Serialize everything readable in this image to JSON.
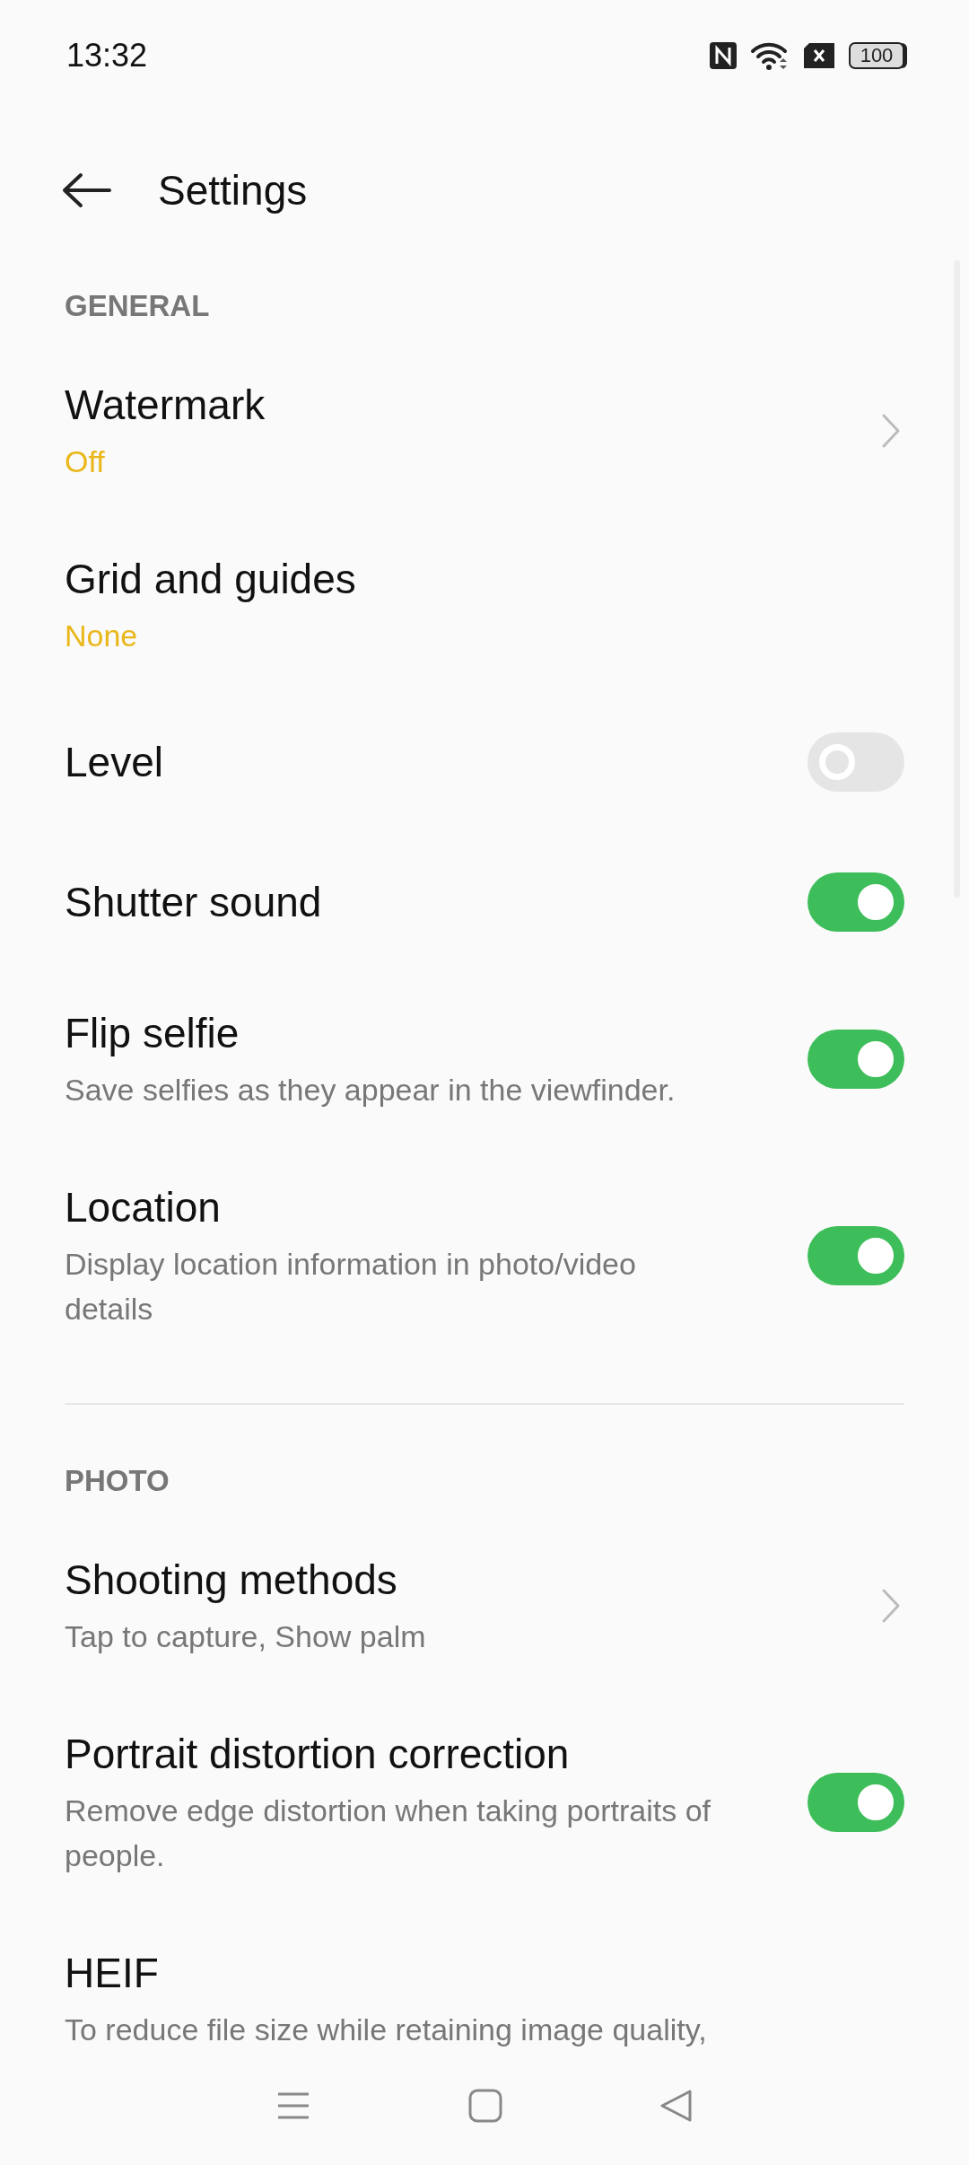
{
  "status_bar": {
    "time": "13:32",
    "battery": "100"
  },
  "app_bar": {
    "title": "Settings"
  },
  "sections": [
    {
      "header": "GENERAL",
      "items": [
        {
          "title": "Watermark",
          "value": "Off",
          "kind": "link"
        },
        {
          "title": "Grid and guides",
          "value": "None",
          "kind": "plain"
        },
        {
          "title": "Level",
          "kind": "switch",
          "on": false
        },
        {
          "title": "Shutter sound",
          "kind": "switch",
          "on": true
        },
        {
          "title": "Flip selfie",
          "description": "Save selfies as they appear in the viewfinder.",
          "kind": "switch",
          "on": true
        },
        {
          "title": "Location",
          "description": "Display location information in photo/video details",
          "kind": "switch",
          "on": true
        }
      ]
    },
    {
      "header": "PHOTO",
      "items": [
        {
          "title": "Shooting methods",
          "description": "Tap to capture, Show palm",
          "kind": "link"
        },
        {
          "title": "Portrait distortion correction",
          "description": "Remove edge distortion when taking portraits of people.",
          "kind": "switch",
          "on": true
        },
        {
          "title": "HEIF",
          "description": "To reduce file size while retaining image quality,",
          "kind": "plain"
        }
      ]
    }
  ]
}
